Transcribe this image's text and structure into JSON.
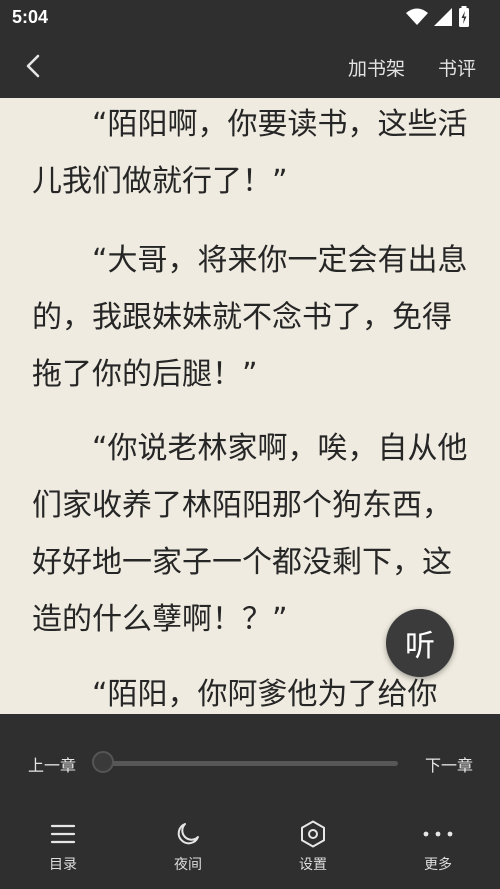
{
  "status": {
    "time": "5:04"
  },
  "header": {
    "add_shelf": "加书架",
    "review": "书评"
  },
  "content": {
    "paragraphs": [
      "“陌阳啊，你要读书，这些活儿我们做就行了！”",
      "“大哥，将来你一定会有出息的，我跟妹妹就不念书了，免得拖了你的后腿！”",
      "“你说老林家啊，唉，自从他们家收养了林陌阳那个狗东西，好好地一家子一个都没剩下，这造的什么孽啊！？”",
      "“陌阳，你阿爹他为了给你"
    ]
  },
  "listen_button": "听",
  "progress": {
    "prev": "上一章",
    "next": "下一章",
    "value": 0
  },
  "bottom_nav": [
    {
      "label": "目录",
      "icon": "menu-icon"
    },
    {
      "label": "夜间",
      "icon": "moon-icon"
    },
    {
      "label": "设置",
      "icon": "settings-icon"
    },
    {
      "label": "更多",
      "icon": "more-icon"
    }
  ],
  "colors": {
    "bar": "#2f2f2f",
    "page_bg": "#efebe0",
    "text": "#262626"
  }
}
